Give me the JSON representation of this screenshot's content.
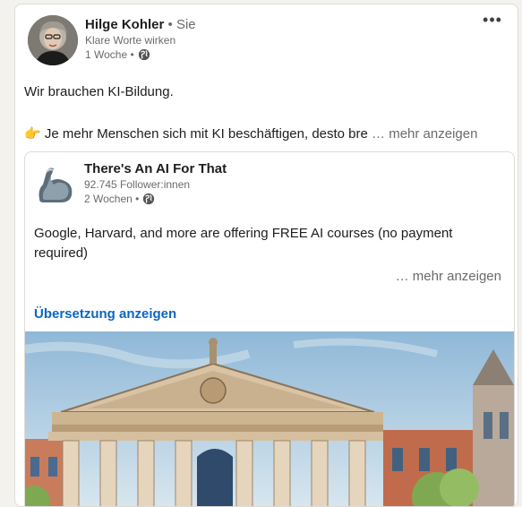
{
  "post": {
    "author_name": "Hilge Kohler",
    "author_relation": " • Sie",
    "author_headline": "Klare Worte wirken",
    "timestamp": "1 Woche •",
    "more_menu": "•••",
    "text_line1": "Wir brauchen KI-Bildung.",
    "text_line2_emoji": "👉",
    "text_line2": " Je mehr Menschen sich mit KI beschäftigen, desto bre",
    "see_more": " … mehr anzeigen"
  },
  "shared": {
    "org_name": "There's An AI For That",
    "followers": "92.745 Follower:innen",
    "timestamp": "2 Wochen •",
    "text": "Google, Harvard, and more are offering FREE AI courses (no payment required)",
    "see_more": "… mehr anzeigen",
    "translate": "Übersetzung anzeigen"
  },
  "icons": {
    "globe": "globe-icon",
    "more": "more-horizontal-icon",
    "logo": "flexed-arm-logo",
    "pointing": "pointing-right-emoji"
  },
  "colors": {
    "link_blue": "#0a66c2",
    "muted": "#6b6b6b",
    "background": "#f4f2ee"
  }
}
